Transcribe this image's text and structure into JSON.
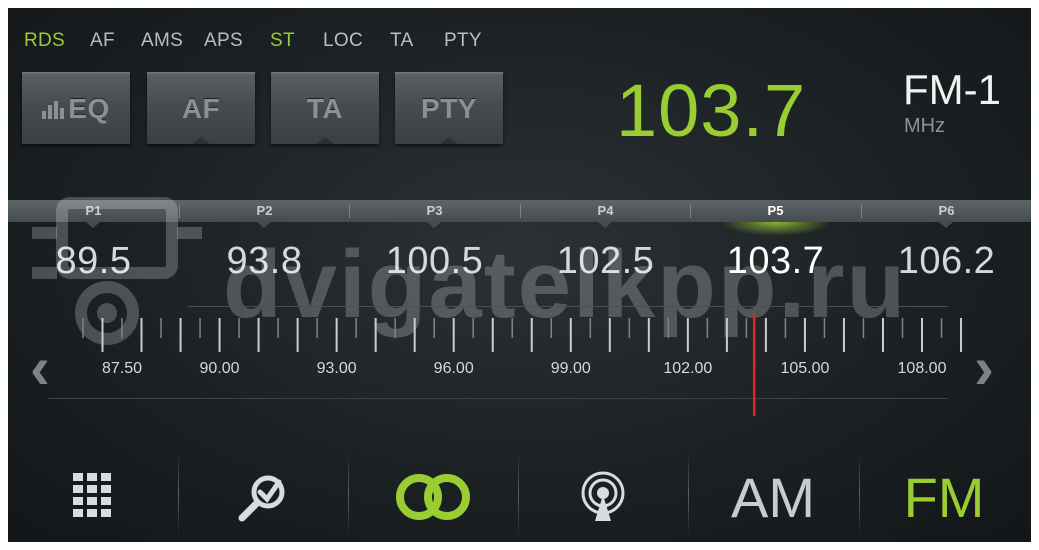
{
  "status": {
    "items": [
      {
        "label": "RDS",
        "active": true
      },
      {
        "label": "AF",
        "active": false
      },
      {
        "label": "AMS",
        "active": false
      },
      {
        "label": "APS",
        "active": false
      },
      {
        "label": "ST",
        "active": true
      },
      {
        "label": "LOC",
        "active": false
      },
      {
        "label": "TA",
        "active": false
      },
      {
        "label": "PTY",
        "active": false
      }
    ]
  },
  "buttons": {
    "eq": "EQ",
    "af": "AF",
    "ta": "TA",
    "pty": "PTY"
  },
  "tuner": {
    "frequency": "103.7",
    "band": "FM-1",
    "unit": "MHz"
  },
  "presets": [
    {
      "label": "P1",
      "value": "89.5",
      "active": false
    },
    {
      "label": "P2",
      "value": "93.8",
      "active": false
    },
    {
      "label": "P3",
      "value": "100.5",
      "active": false
    },
    {
      "label": "P4",
      "value": "102.5",
      "active": false
    },
    {
      "label": "P5",
      "value": "103.7",
      "active": true
    },
    {
      "label": "P6",
      "value": "106.2",
      "active": false
    }
  ],
  "scale": {
    "min": 86.5,
    "max": 109.5,
    "tick_labels": [
      "87.50",
      "90.00",
      "93.00",
      "96.00",
      "99.00",
      "102.00",
      "105.00",
      "108.00"
    ],
    "current": 103.7
  },
  "watermark": {
    "text": "dvigatelkpp.ru"
  },
  "bottom": {
    "am_label": "AM",
    "fm_label": "FM",
    "active_band": "FM"
  },
  "colors": {
    "accent": "#9acd32",
    "needle": "#e0262b",
    "text": "#d6d9db"
  }
}
